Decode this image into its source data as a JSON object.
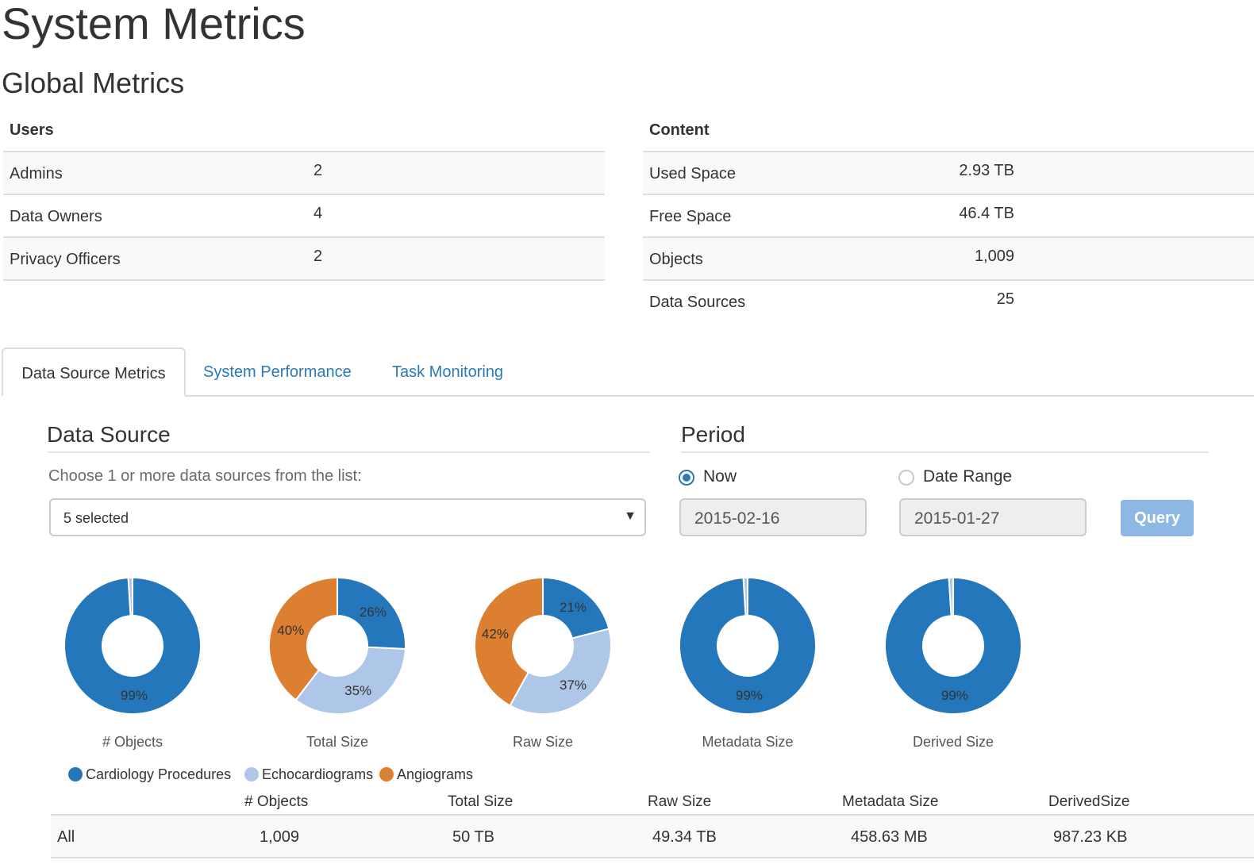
{
  "page": {
    "title": "System Metrics",
    "subtitle": "Global Metrics"
  },
  "users_table": {
    "header": "Users",
    "rows": [
      {
        "label": "Admins",
        "value": "2"
      },
      {
        "label": "Data Owners",
        "value": "4"
      },
      {
        "label": "Privacy Officers",
        "value": "2"
      }
    ]
  },
  "content_table": {
    "header": "Content",
    "rows": [
      {
        "label": "Used Space",
        "value": "2.93 TB"
      },
      {
        "label": "Free Space",
        "value": "46.4 TB"
      },
      {
        "label": "Objects",
        "value": "1,009"
      },
      {
        "label": "Data Sources",
        "value": "25"
      }
    ]
  },
  "tabs": [
    {
      "label": "Data Source Metrics",
      "active": true
    },
    {
      "label": "System Performance",
      "active": false
    },
    {
      "label": "Task Monitoring",
      "active": false
    }
  ],
  "data_source": {
    "title": "Data Source",
    "help": "Choose 1 or more data sources from the list:",
    "selected_label": "5 selected",
    "caret_icon": "▼"
  },
  "period": {
    "title": "Period",
    "options": [
      {
        "label": "Now",
        "checked": true
      },
      {
        "label": "Date Range",
        "checked": false
      }
    ],
    "date_from": "2015-02-16",
    "date_to": "2015-01-27",
    "query_label": "Query"
  },
  "colors": {
    "Cardiology Procedures": "#2477bb",
    "Echocardiograms": "#aec7e8",
    "Angiograms": "#dd7f31"
  },
  "chart_data": [
    {
      "type": "pie",
      "title": "# Objects",
      "slices": [
        {
          "name": "Cardiology Procedures",
          "value": 99,
          "label": "99%"
        },
        {
          "name": "Echocardiograms",
          "value": 1,
          "label": ""
        }
      ]
    },
    {
      "type": "pie",
      "title": "Total Size",
      "slices": [
        {
          "name": "Cardiology Procedures",
          "value": 26,
          "label": "26%"
        },
        {
          "name": "Echocardiograms",
          "value": 35,
          "label": "35%"
        },
        {
          "name": "Angiograms",
          "value": 40,
          "label": "40%"
        }
      ]
    },
    {
      "type": "pie",
      "title": "Raw Size",
      "slices": [
        {
          "name": "Cardiology Procedures",
          "value": 21,
          "label": "21%"
        },
        {
          "name": "Echocardiograms",
          "value": 37,
          "label": "37%"
        },
        {
          "name": "Angiograms",
          "value": 42,
          "label": "42%"
        }
      ]
    },
    {
      "type": "pie",
      "title": "Metadata Size",
      "slices": [
        {
          "name": "Cardiology Procedures",
          "value": 99,
          "label": "99%"
        },
        {
          "name": "Echocardiograms",
          "value": 1,
          "label": ""
        }
      ]
    },
    {
      "type": "pie",
      "title": "Derived Size",
      "slices": [
        {
          "name": "Cardiology Procedures",
          "value": 99,
          "label": "99%"
        },
        {
          "name": "Echocardiograms",
          "value": 1,
          "label": ""
        }
      ]
    }
  ],
  "legend": [
    "Cardiology Procedures",
    "Echocardiograms",
    "Angiograms"
  ],
  "summary_table": {
    "headers": [
      "# Objects",
      "Total Size",
      "Raw Size",
      "Metadata Size",
      "DerivedSize"
    ],
    "rows": [
      {
        "label": "All",
        "values": [
          "1,009",
          "50 TB",
          "49.34 TB",
          "458.63 MB",
          "987.23 KB"
        ]
      }
    ]
  }
}
